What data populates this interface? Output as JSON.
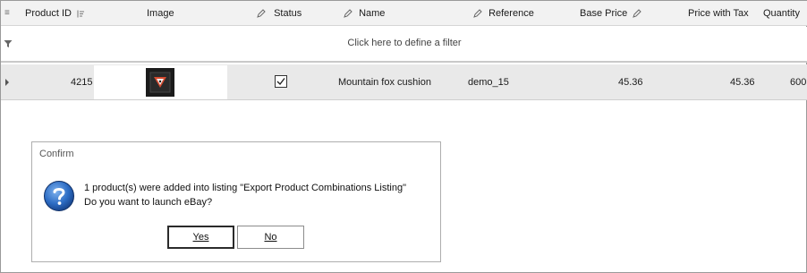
{
  "grid": {
    "columns": [
      {
        "key": "product_id",
        "label": "Product ID",
        "icon": "sort-icon"
      },
      {
        "key": "image",
        "label": "Image"
      },
      {
        "key": "status",
        "label": "Status",
        "icon": "pencil-icon"
      },
      {
        "key": "name",
        "label": "Name",
        "icon": "pencil-icon"
      },
      {
        "key": "reference",
        "label": "Reference",
        "icon": "pencil-icon"
      },
      {
        "key": "base_price",
        "label": "Base Price",
        "icon": "pencil-icon"
      },
      {
        "key": "price_with_tax",
        "label": "Price with Tax"
      },
      {
        "key": "quantity",
        "label": "Quantity"
      }
    ],
    "filter_prompt": "Click here to define a filter",
    "row": {
      "product_id": "4215",
      "status_checked": true,
      "name": "Mountain fox cushion",
      "reference": "demo_15",
      "base_price": "45.36",
      "price_with_tax": "45.36",
      "quantity": "600"
    }
  },
  "dialog": {
    "title": "Confirm",
    "icon": "question-icon",
    "message_line1": "1 product(s) were added into listing \"Export Product Combinations Listing\"",
    "message_line2": "Do you want to launch eBay?",
    "yes_label": "Yes",
    "no_label": "No"
  },
  "colors": {
    "header_bg": "#f2f2f2",
    "row_bg": "#e9e9e9",
    "question_icon": "#1f5fb7"
  }
}
